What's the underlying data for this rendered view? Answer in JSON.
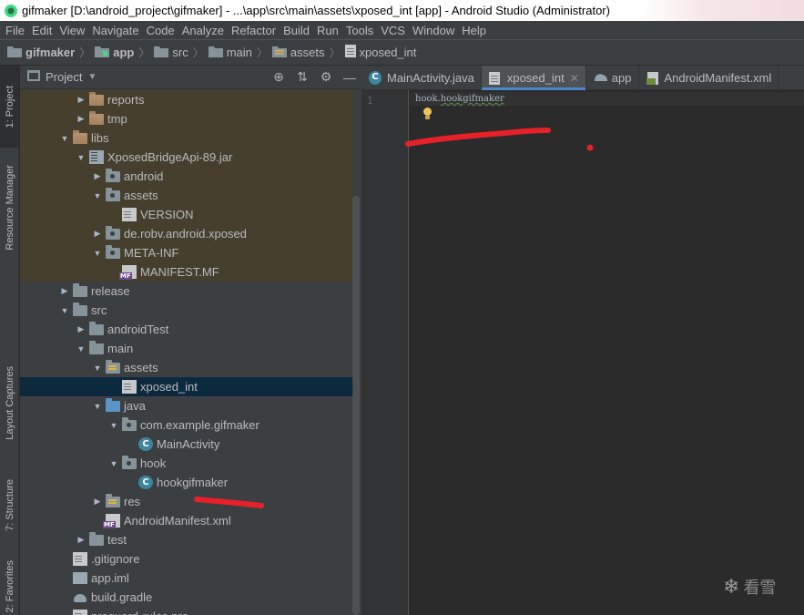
{
  "window": {
    "title": "gifmaker [D:\\android_project\\gifmaker] - ...\\app\\src\\main\\assets\\xposed_int [app] - Android Studio (Administrator)"
  },
  "menu": [
    "File",
    "Edit",
    "View",
    "Navigate",
    "Code",
    "Analyze",
    "Refactor",
    "Build",
    "Run",
    "Tools",
    "VCS",
    "Window",
    "Help"
  ],
  "breadcrumb": [
    "gifmaker",
    "app",
    "src",
    "main",
    "assets",
    "xposed_int"
  ],
  "left_stripe": {
    "project": "1: Project",
    "resource_manager": "Resource Manager",
    "layout_captures": "Layout Captures",
    "structure": "7: Structure",
    "favorites": "2: Favorites"
  },
  "project_panel": {
    "title": "Project",
    "tree": [
      {
        "label": "reports",
        "depth": 3,
        "expander": "collapsed",
        "icon": "folder",
        "lib": true
      },
      {
        "label": "tmp",
        "depth": 3,
        "expander": "collapsed",
        "icon": "folder",
        "lib": true
      },
      {
        "label": "libs",
        "depth": 2,
        "expander": "expanded",
        "icon": "folder",
        "lib": true
      },
      {
        "label": "XposedBridgeApi-89.jar",
        "depth": 3,
        "expander": "expanded",
        "icon": "jar",
        "lib": true
      },
      {
        "label": "android",
        "depth": 4,
        "expander": "collapsed",
        "icon": "package",
        "lib": true
      },
      {
        "label": "assets",
        "depth": 4,
        "expander": "expanded",
        "icon": "package",
        "lib": true
      },
      {
        "label": "VERSION",
        "depth": 5,
        "expander": "none",
        "icon": "file",
        "lib": true
      },
      {
        "label": "de.robv.android.xposed",
        "depth": 4,
        "expander": "collapsed",
        "icon": "package",
        "lib": true
      },
      {
        "label": "META-INF",
        "depth": 4,
        "expander": "expanded",
        "icon": "package",
        "lib": true
      },
      {
        "label": "MANIFEST.MF",
        "depth": 5,
        "expander": "none",
        "icon": "mf",
        "lib": true
      },
      {
        "label": "release",
        "depth": 2,
        "expander": "collapsed",
        "icon": "folder-grey"
      },
      {
        "label": "src",
        "depth": 2,
        "expander": "expanded",
        "icon": "folder-grey"
      },
      {
        "label": "androidTest",
        "depth": 3,
        "expander": "collapsed",
        "icon": "folder-grey"
      },
      {
        "label": "main",
        "depth": 3,
        "expander": "expanded",
        "icon": "folder-grey"
      },
      {
        "label": "assets",
        "depth": 4,
        "expander": "expanded",
        "icon": "res"
      },
      {
        "label": "xposed_int",
        "depth": 5,
        "expander": "none",
        "icon": "file",
        "selected": true
      },
      {
        "label": "java",
        "depth": 4,
        "expander": "expanded",
        "icon": "folder-blue"
      },
      {
        "label": "com.example.gifmaker",
        "depth": 5,
        "expander": "expanded",
        "icon": "package-grey"
      },
      {
        "label": "MainActivity",
        "depth": 6,
        "expander": "none",
        "icon": "class"
      },
      {
        "label": "hook",
        "depth": 5,
        "expander": "expanded",
        "icon": "package-grey"
      },
      {
        "label": "hookgifmaker",
        "depth": 6,
        "expander": "none",
        "icon": "class"
      },
      {
        "label": "res",
        "depth": 4,
        "expander": "collapsed",
        "icon": "res"
      },
      {
        "label": "AndroidManifest.xml",
        "depth": 4,
        "expander": "none",
        "icon": "mf"
      },
      {
        "label": "test",
        "depth": 3,
        "expander": "collapsed",
        "icon": "folder-grey"
      },
      {
        "label": ".gitignore",
        "depth": 2,
        "expander": "none",
        "icon": "file"
      },
      {
        "label": "app.iml",
        "depth": 2,
        "expander": "none",
        "icon": "iml"
      },
      {
        "label": "build.gradle",
        "depth": 2,
        "expander": "none",
        "icon": "gradle"
      },
      {
        "label": "proguard-rules.pro",
        "depth": 2,
        "expander": "none",
        "icon": "file"
      }
    ]
  },
  "editor": {
    "tabs": [
      {
        "label": "MainActivity.java",
        "active": false,
        "icon": "class-icon"
      },
      {
        "label": "xposed_int",
        "active": true,
        "icon": "file-icon",
        "closable": true
      },
      {
        "label": "app",
        "active": false,
        "icon": "gradle-icon"
      },
      {
        "label": "AndroidManifest.xml",
        "active": false,
        "icon": "manifest-icon"
      }
    ],
    "line_numbers": [
      "1"
    ],
    "code": {
      "prefix": "hook.",
      "word": "hookgifmaker"
    }
  },
  "watermark": {
    "text": "看雪"
  },
  "colors": {
    "accent": "#4a88c7",
    "annotation": "#e8202a",
    "selection": "#0d293e",
    "library_row": "#463f2e"
  }
}
